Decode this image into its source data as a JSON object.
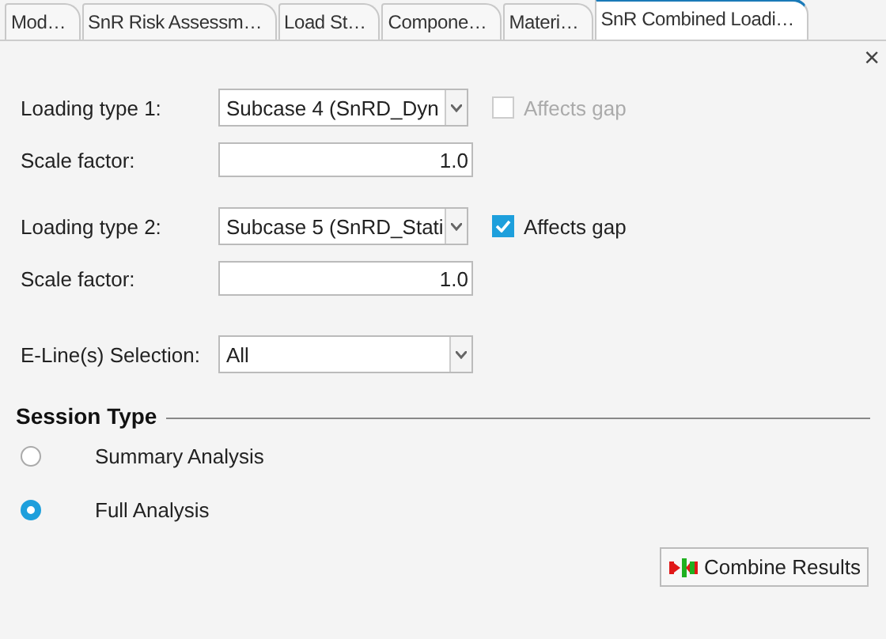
{
  "tabs": [
    {
      "label": "Mod…",
      "selected": false
    },
    {
      "label": "SnR Risk Assessm…",
      "selected": false
    },
    {
      "label": "Load St…",
      "selected": false
    },
    {
      "label": "Compone…",
      "selected": false
    },
    {
      "label": "Materi…",
      "selected": false
    },
    {
      "label": "SnR Combined Loadi…",
      "selected": true
    }
  ],
  "close": "×",
  "loadings": [
    {
      "label": "Loading type 1:",
      "value": "Subcase 4 (SnRD_Dyn",
      "affects_gap": {
        "label": "Affects gap",
        "checked": false,
        "disabled": true
      },
      "scale_label": "Scale factor:",
      "scale_value": "1.0"
    },
    {
      "label": "Loading type 2:",
      "value": "Subcase 5 (SnRD_Stati",
      "affects_gap": {
        "label": "Affects gap",
        "checked": true,
        "disabled": false
      },
      "scale_label": "Scale factor:",
      "scale_value": "1.0"
    }
  ],
  "eline": {
    "label": "E-Line(s) Selection:",
    "value": "All"
  },
  "session_type": {
    "title": "Session Type",
    "options": [
      {
        "label": "Summary Analysis",
        "selected": false
      },
      {
        "label": "Full Analysis",
        "selected": true
      }
    ]
  },
  "buttons": [
    "Combine Results"
  ]
}
